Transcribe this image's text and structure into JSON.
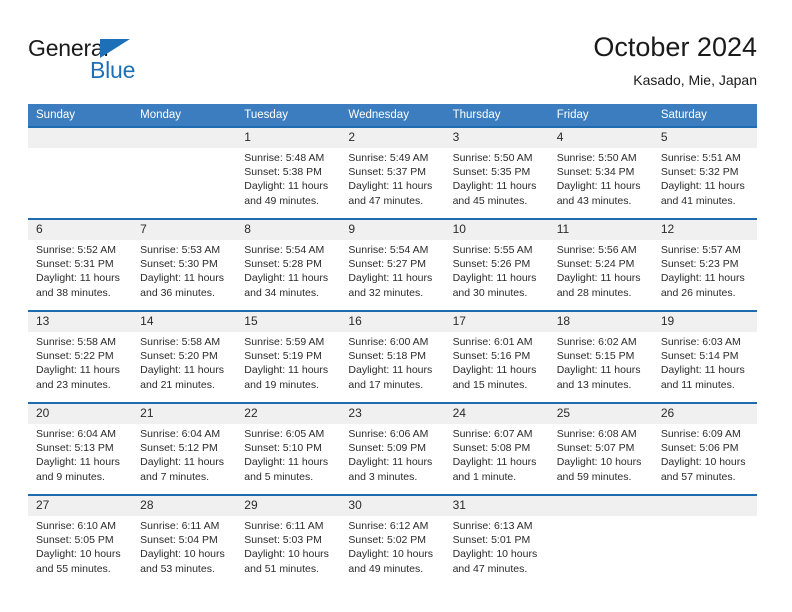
{
  "brand": {
    "name_primary": "General",
    "name_secondary": "Blue",
    "triangle_color": "#1d70b8"
  },
  "header": {
    "title": "October 2024",
    "subtitle": "Kasado, Mie, Japan"
  },
  "colors": {
    "header_blue": "#3b7dbf",
    "rule_blue": "#1f6bb0",
    "daynum_bg": "#f0f0f0",
    "text": "#2b2b2b"
  },
  "weekday_headers": [
    "Sunday",
    "Monday",
    "Tuesday",
    "Wednesday",
    "Thursday",
    "Friday",
    "Saturday"
  ],
  "weeks": [
    [
      {
        "day": "",
        "sunrise": "",
        "sunset": "",
        "daylight_line1": "",
        "daylight_line2": ""
      },
      {
        "day": "",
        "sunrise": "",
        "sunset": "",
        "daylight_line1": "",
        "daylight_line2": ""
      },
      {
        "day": "1",
        "sunrise": "Sunrise: 5:48 AM",
        "sunset": "Sunset: 5:38 PM",
        "daylight_line1": "Daylight: 11 hours",
        "daylight_line2": "and 49 minutes."
      },
      {
        "day": "2",
        "sunrise": "Sunrise: 5:49 AM",
        "sunset": "Sunset: 5:37 PM",
        "daylight_line1": "Daylight: 11 hours",
        "daylight_line2": "and 47 minutes."
      },
      {
        "day": "3",
        "sunrise": "Sunrise: 5:50 AM",
        "sunset": "Sunset: 5:35 PM",
        "daylight_line1": "Daylight: 11 hours",
        "daylight_line2": "and 45 minutes."
      },
      {
        "day": "4",
        "sunrise": "Sunrise: 5:50 AM",
        "sunset": "Sunset: 5:34 PM",
        "daylight_line1": "Daylight: 11 hours",
        "daylight_line2": "and 43 minutes."
      },
      {
        "day": "5",
        "sunrise": "Sunrise: 5:51 AM",
        "sunset": "Sunset: 5:32 PM",
        "daylight_line1": "Daylight: 11 hours",
        "daylight_line2": "and 41 minutes."
      }
    ],
    [
      {
        "day": "6",
        "sunrise": "Sunrise: 5:52 AM",
        "sunset": "Sunset: 5:31 PM",
        "daylight_line1": "Daylight: 11 hours",
        "daylight_line2": "and 38 minutes."
      },
      {
        "day": "7",
        "sunrise": "Sunrise: 5:53 AM",
        "sunset": "Sunset: 5:30 PM",
        "daylight_line1": "Daylight: 11 hours",
        "daylight_line2": "and 36 minutes."
      },
      {
        "day": "8",
        "sunrise": "Sunrise: 5:54 AM",
        "sunset": "Sunset: 5:28 PM",
        "daylight_line1": "Daylight: 11 hours",
        "daylight_line2": "and 34 minutes."
      },
      {
        "day": "9",
        "sunrise": "Sunrise: 5:54 AM",
        "sunset": "Sunset: 5:27 PM",
        "daylight_line1": "Daylight: 11 hours",
        "daylight_line2": "and 32 minutes."
      },
      {
        "day": "10",
        "sunrise": "Sunrise: 5:55 AM",
        "sunset": "Sunset: 5:26 PM",
        "daylight_line1": "Daylight: 11 hours",
        "daylight_line2": "and 30 minutes."
      },
      {
        "day": "11",
        "sunrise": "Sunrise: 5:56 AM",
        "sunset": "Sunset: 5:24 PM",
        "daylight_line1": "Daylight: 11 hours",
        "daylight_line2": "and 28 minutes."
      },
      {
        "day": "12",
        "sunrise": "Sunrise: 5:57 AM",
        "sunset": "Sunset: 5:23 PM",
        "daylight_line1": "Daylight: 11 hours",
        "daylight_line2": "and 26 minutes."
      }
    ],
    [
      {
        "day": "13",
        "sunrise": "Sunrise: 5:58 AM",
        "sunset": "Sunset: 5:22 PM",
        "daylight_line1": "Daylight: 11 hours",
        "daylight_line2": "and 23 minutes."
      },
      {
        "day": "14",
        "sunrise": "Sunrise: 5:58 AM",
        "sunset": "Sunset: 5:20 PM",
        "daylight_line1": "Daylight: 11 hours",
        "daylight_line2": "and 21 minutes."
      },
      {
        "day": "15",
        "sunrise": "Sunrise: 5:59 AM",
        "sunset": "Sunset: 5:19 PM",
        "daylight_line1": "Daylight: 11 hours",
        "daylight_line2": "and 19 minutes."
      },
      {
        "day": "16",
        "sunrise": "Sunrise: 6:00 AM",
        "sunset": "Sunset: 5:18 PM",
        "daylight_line1": "Daylight: 11 hours",
        "daylight_line2": "and 17 minutes."
      },
      {
        "day": "17",
        "sunrise": "Sunrise: 6:01 AM",
        "sunset": "Sunset: 5:16 PM",
        "daylight_line1": "Daylight: 11 hours",
        "daylight_line2": "and 15 minutes."
      },
      {
        "day": "18",
        "sunrise": "Sunrise: 6:02 AM",
        "sunset": "Sunset: 5:15 PM",
        "daylight_line1": "Daylight: 11 hours",
        "daylight_line2": "and 13 minutes."
      },
      {
        "day": "19",
        "sunrise": "Sunrise: 6:03 AM",
        "sunset": "Sunset: 5:14 PM",
        "daylight_line1": "Daylight: 11 hours",
        "daylight_line2": "and 11 minutes."
      }
    ],
    [
      {
        "day": "20",
        "sunrise": "Sunrise: 6:04 AM",
        "sunset": "Sunset: 5:13 PM",
        "daylight_line1": "Daylight: 11 hours",
        "daylight_line2": "and 9 minutes."
      },
      {
        "day": "21",
        "sunrise": "Sunrise: 6:04 AM",
        "sunset": "Sunset: 5:12 PM",
        "daylight_line1": "Daylight: 11 hours",
        "daylight_line2": "and 7 minutes."
      },
      {
        "day": "22",
        "sunrise": "Sunrise: 6:05 AM",
        "sunset": "Sunset: 5:10 PM",
        "daylight_line1": "Daylight: 11 hours",
        "daylight_line2": "and 5 minutes."
      },
      {
        "day": "23",
        "sunrise": "Sunrise: 6:06 AM",
        "sunset": "Sunset: 5:09 PM",
        "daylight_line1": "Daylight: 11 hours",
        "daylight_line2": "and 3 minutes."
      },
      {
        "day": "24",
        "sunrise": "Sunrise: 6:07 AM",
        "sunset": "Sunset: 5:08 PM",
        "daylight_line1": "Daylight: 11 hours",
        "daylight_line2": "and 1 minute."
      },
      {
        "day": "25",
        "sunrise": "Sunrise: 6:08 AM",
        "sunset": "Sunset: 5:07 PM",
        "daylight_line1": "Daylight: 10 hours",
        "daylight_line2": "and 59 minutes."
      },
      {
        "day": "26",
        "sunrise": "Sunrise: 6:09 AM",
        "sunset": "Sunset: 5:06 PM",
        "daylight_line1": "Daylight: 10 hours",
        "daylight_line2": "and 57 minutes."
      }
    ],
    [
      {
        "day": "27",
        "sunrise": "Sunrise: 6:10 AM",
        "sunset": "Sunset: 5:05 PM",
        "daylight_line1": "Daylight: 10 hours",
        "daylight_line2": "and 55 minutes."
      },
      {
        "day": "28",
        "sunrise": "Sunrise: 6:11 AM",
        "sunset": "Sunset: 5:04 PM",
        "daylight_line1": "Daylight: 10 hours",
        "daylight_line2": "and 53 minutes."
      },
      {
        "day": "29",
        "sunrise": "Sunrise: 6:11 AM",
        "sunset": "Sunset: 5:03 PM",
        "daylight_line1": "Daylight: 10 hours",
        "daylight_line2": "and 51 minutes."
      },
      {
        "day": "30",
        "sunrise": "Sunrise: 6:12 AM",
        "sunset": "Sunset: 5:02 PM",
        "daylight_line1": "Daylight: 10 hours",
        "daylight_line2": "and 49 minutes."
      },
      {
        "day": "31",
        "sunrise": "Sunrise: 6:13 AM",
        "sunset": "Sunset: 5:01 PM",
        "daylight_line1": "Daylight: 10 hours",
        "daylight_line2": "and 47 minutes."
      },
      {
        "day": "",
        "sunrise": "",
        "sunset": "",
        "daylight_line1": "",
        "daylight_line2": ""
      },
      {
        "day": "",
        "sunrise": "",
        "sunset": "",
        "daylight_line1": "",
        "daylight_line2": ""
      }
    ]
  ]
}
